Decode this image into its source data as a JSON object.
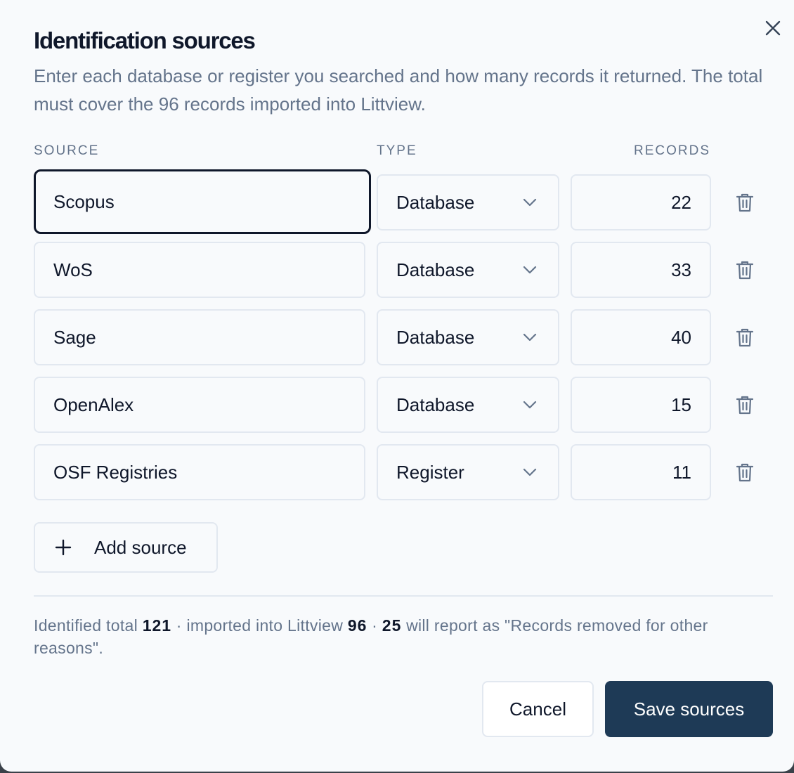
{
  "dialog": {
    "title": "Identification sources",
    "description": "Enter each database or register you searched and how many records it returned. The total must cover the 96 records imported into Littview."
  },
  "columns": {
    "source": "SOURCE",
    "type": "TYPE",
    "records": "RECORDS"
  },
  "rows": [
    {
      "source": "Scopus",
      "type": "Database",
      "records": "22",
      "focused": true
    },
    {
      "source": "WoS",
      "type": "Database",
      "records": "33"
    },
    {
      "source": "Sage",
      "type": "Database",
      "records": "40"
    },
    {
      "source": "OpenAlex",
      "type": "Database",
      "records": "15"
    },
    {
      "source": "OSF Registries",
      "type": "Register",
      "records": "11"
    }
  ],
  "add_button": {
    "label": "Add source",
    "icon": "plus-icon"
  },
  "summary": {
    "identified_label": "Identified total",
    "identified_value": "121",
    "sep1": "·",
    "imported_label": "imported into Littview",
    "imported_value": "96",
    "sep2": "·",
    "removed_value": "25",
    "removed_text": "will report as \"Records removed for other reasons\"."
  },
  "buttons": {
    "cancel": "Cancel",
    "save": "Save sources"
  },
  "icons": {
    "close": "close-icon",
    "trash": "trash-icon",
    "chevron": "chevron-down-icon"
  },
  "colors": {
    "primary": "#1e3a56",
    "text": "#0f172a",
    "muted": "#64748b",
    "border": "#e2e8f0",
    "background": "#f8fafc"
  }
}
